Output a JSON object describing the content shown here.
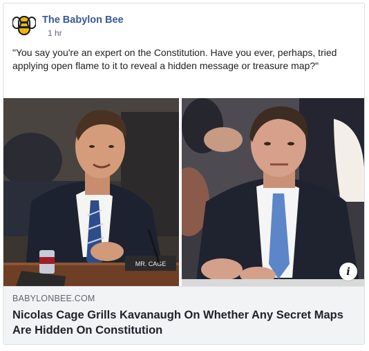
{
  "post": {
    "page_name": "The Babylon Bee",
    "timestamp": "1 hr",
    "text": "\"You say you're an expert on the Constitution. Have you ever, perhaps, tried applying open flame to it to reveal a hidden message or treasure map?\""
  },
  "media": {
    "placard": "MR. CAGE",
    "info_icon": "info-icon"
  },
  "link": {
    "domain": "BABYLONBEE.COM",
    "title": "Nicolas Cage Grills Kavanaugh On Whether Any Secret Maps Are Hidden On Constitution"
  },
  "colors": {
    "link_blue": "#385898",
    "preview_bg": "#f2f3f5",
    "border": "#dddfe2"
  }
}
